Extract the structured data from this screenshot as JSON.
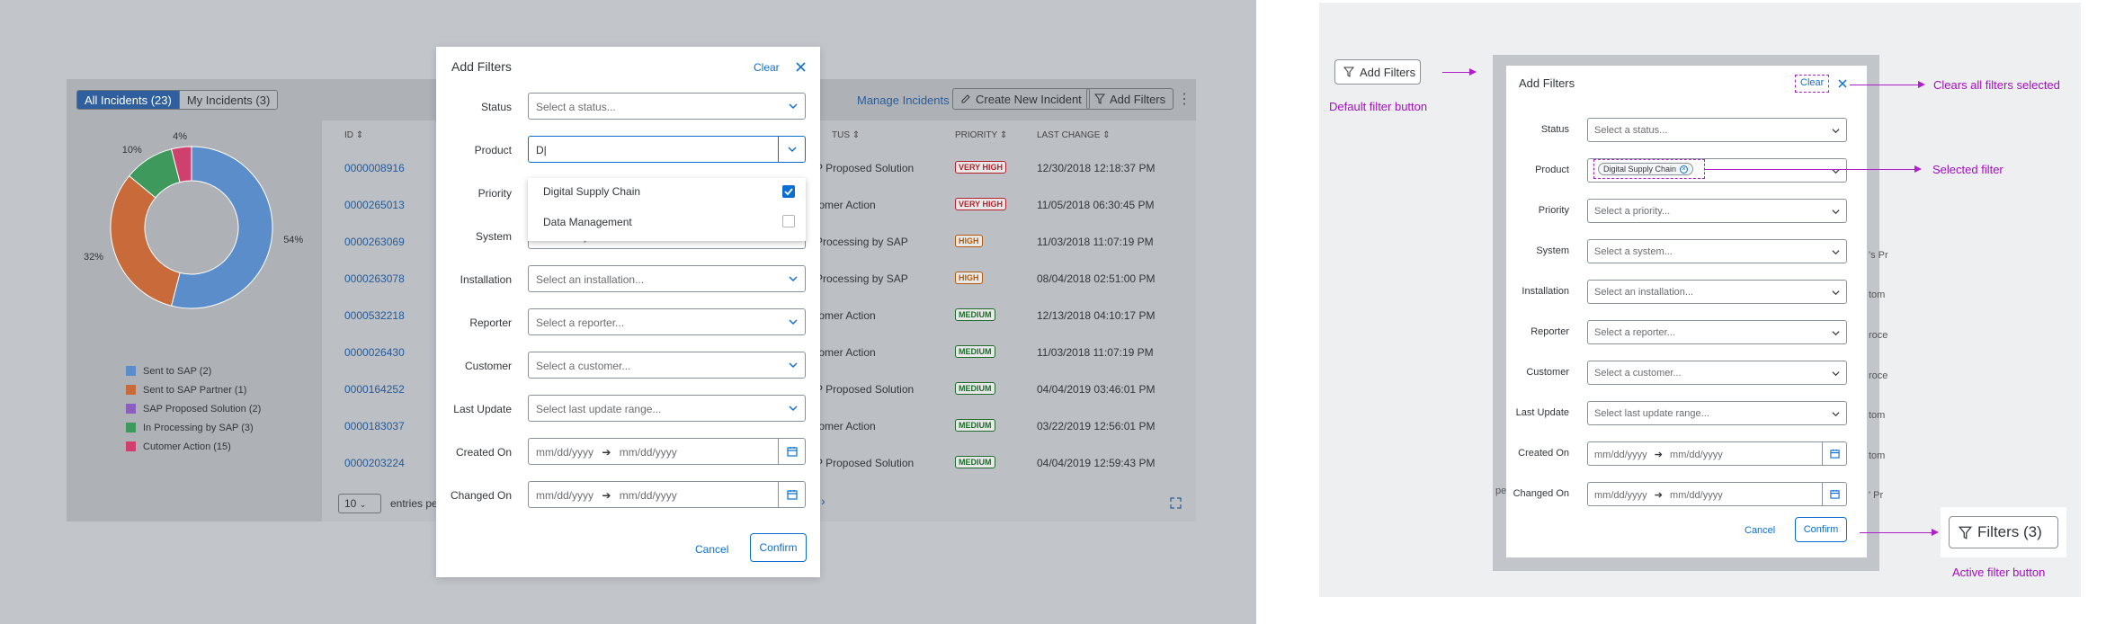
{
  "app": {
    "tabs": [
      "All Incidents (23)",
      "My Incidents (3)"
    ],
    "manage_label": "Manage Incidents",
    "create_label": "Create New Incident",
    "add_filters_label": "Add Filters"
  },
  "chart_data": {
    "type": "pie",
    "variant": "donut",
    "slices": [
      {
        "name": "Sent to SAP (2)",
        "value": 54,
        "label": "54%",
        "color": "#5b8dcb"
      },
      {
        "name": "Sent to SAP Partner (1)",
        "value": 32,
        "label": "32%",
        "color": "#c86a3a"
      },
      {
        "name": "SAP Proposed Solution (2)",
        "value": 0,
        "label": "",
        "color": "#8a5fbf"
      },
      {
        "name": "In Processing by SAP (3)",
        "value": 10,
        "label": "10%",
        "color": "#3e9a5c"
      },
      {
        "name": "Cutomer Action (15)",
        "value": 4,
        "label": "4%",
        "color": "#d0406f"
      }
    ]
  },
  "table": {
    "headers": [
      "ID",
      "TUS",
      "PRIORITY",
      "LAST CHANGE"
    ],
    "rows": [
      {
        "id": "0000008916",
        "status": "P Proposed Solution",
        "priority": "VERY HIGH",
        "level": "vh",
        "changed": "12/30/2018 12:18:37 PM"
      },
      {
        "id": "0000265013",
        "status": "tomer Action",
        "priority": "VERY HIGH",
        "level": "vh",
        "changed": "11/05/2018 06:30:45 PM"
      },
      {
        "id": "0000263069",
        "status": "Processing by SAP",
        "priority": "HIGH",
        "level": "hi",
        "changed": "11/03/2018 11:07:19 PM"
      },
      {
        "id": "0000263078",
        "status": "Processing by SAP",
        "priority": "HIGH",
        "level": "hi",
        "changed": "08/04/2018 02:51:00 PM"
      },
      {
        "id": "0000532218",
        "status": "tomer Action",
        "priority": "MEDIUM",
        "level": "md",
        "changed": "12/13/2018 04:10:17 PM"
      },
      {
        "id": "0000026430",
        "status": "tomer Action",
        "priority": "MEDIUM",
        "level": "md",
        "changed": "11/03/2018 11:07:19 PM"
      },
      {
        "id": "0000164252",
        "status": "P Proposed Solution",
        "priority": "MEDIUM",
        "level": "md",
        "changed": "04/04/2019 03:46:01 PM"
      },
      {
        "id": "0000183037",
        "status": "tomer Action",
        "priority": "MEDIUM",
        "level": "md",
        "changed": "03/22/2019 12:56:01 PM"
      },
      {
        "id": "0000203224",
        "status": "P Proposed Solution",
        "priority": "MEDIUM",
        "level": "md",
        "changed": "04/04/2019 12:59:43 PM"
      }
    ],
    "page_size": "10",
    "entries_label": "entries pe"
  },
  "dialog": {
    "title": "Add Filters",
    "clear": "Clear",
    "fields": [
      {
        "label": "Status",
        "placeholder": "Select a status..."
      },
      {
        "label": "Product",
        "value": "D"
      },
      {
        "label": "Priority",
        "placeholder": "Select a priority..."
      },
      {
        "label": "System",
        "placeholder": "Select a system..."
      },
      {
        "label": "Installation",
        "placeholder": "Select an installation..."
      },
      {
        "label": "Reporter",
        "placeholder": "Select a reporter..."
      },
      {
        "label": "Customer",
        "placeholder": "Select a customer..."
      },
      {
        "label": "Last Update",
        "placeholder": "Select last update range..."
      }
    ],
    "date_fields": [
      {
        "label": "Created On",
        "from": "mm/dd/yyyy",
        "to": "mm/dd/yyyy"
      },
      {
        "label": "Changed On",
        "from": "mm/dd/yyyy",
        "to": "mm/dd/yyyy"
      }
    ],
    "dropdown": [
      {
        "label": "Digital Supply Chain",
        "checked": true
      },
      {
        "label": "Data Management",
        "checked": false
      }
    ],
    "cancel": "Cancel",
    "confirm": "Confirm"
  },
  "annotated": {
    "default_button": "Add Filters",
    "default_caption": "Default filter button",
    "clear_caption": "Clears all filters selected",
    "selected_caption": "Selected filter",
    "active_button": "Filters (3)",
    "active_caption": "Active filter button",
    "chip": "Digital Supply Chain",
    "bg_fragments": [
      "S",
      "'s Pr",
      "tom",
      "roce",
      "roce",
      "tom",
      "tom",
      "' Pr",
      "tom",
      "' Pr",
      "pe"
    ],
    "accent": "#a40ec4"
  }
}
